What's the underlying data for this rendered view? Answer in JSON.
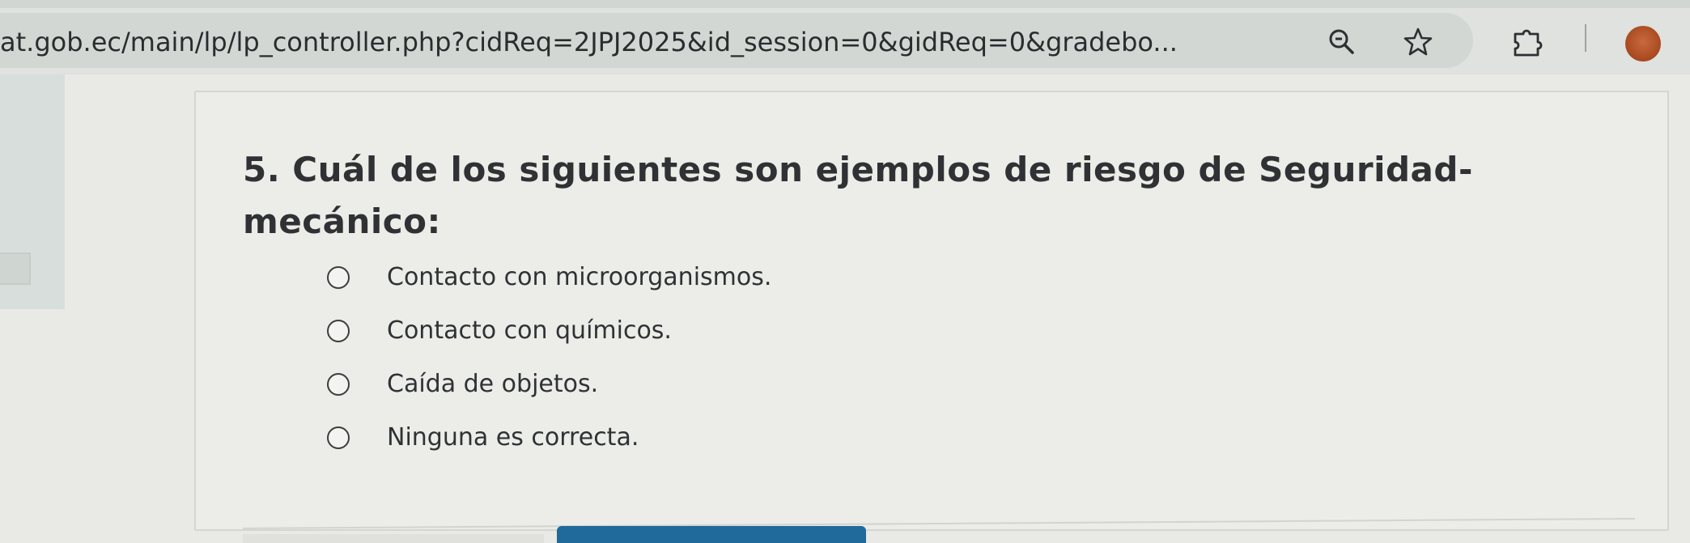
{
  "browser": {
    "url": "at.gob.ec/main/lp/lp_controller.php?cidReq=2JPJ2025&id_session=0&gidReq=0&gradebo...",
    "icons": [
      "zoom-icon",
      "star-icon",
      "extension-icon",
      "avatar"
    ]
  },
  "quiz": {
    "question": "5. Cuál de los siguientes son ejemplos de riesgo de Seguridad-mecánico:",
    "options": [
      {
        "label": "Contacto con microorganismos."
      },
      {
        "label": "Contacto con químicos."
      },
      {
        "label": "Caída de objetos."
      },
      {
        "label": "Ninguna es correcta."
      }
    ]
  },
  "colors": {
    "accent_button": "#1f6a9b",
    "avatar": "#b5522a"
  }
}
